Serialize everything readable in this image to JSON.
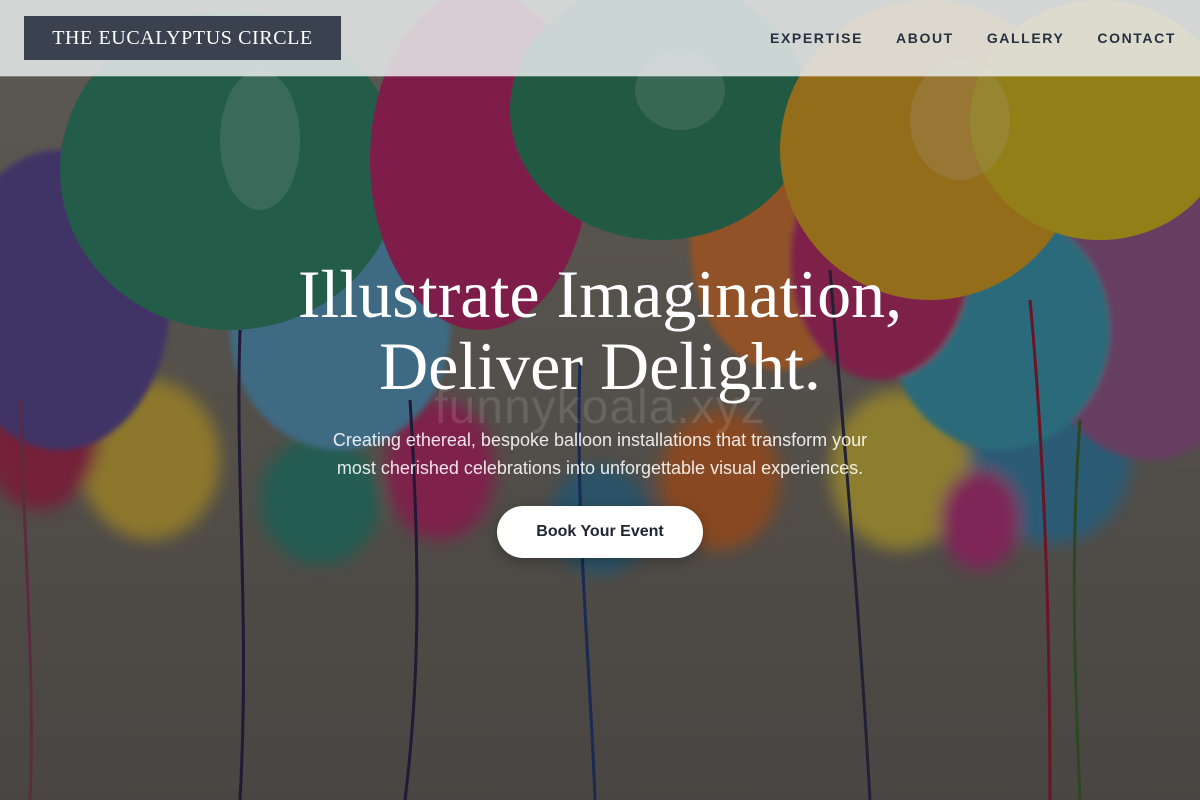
{
  "brand": {
    "name": "THE EUCALYPTUS CIRCLE"
  },
  "nav": {
    "items": [
      {
        "label": "EXPERTISE"
      },
      {
        "label": "ABOUT"
      },
      {
        "label": "GALLERY"
      },
      {
        "label": "CONTACT"
      }
    ]
  },
  "hero": {
    "headline_line1": "Illustrate Imagination,",
    "headline_line2": "Deliver Delight.",
    "subtitle_line1": "Creating ethereal, bespoke balloon installations that transform your",
    "subtitle_line2": "most cherished celebrations into unforgettable visual experiences.",
    "cta_label": "Book Your Event",
    "watermark": "funnykoala.xyz",
    "background_image": "colorful-balloons-photo"
  },
  "colors": {
    "brand_box": "#3a4250",
    "nav_text": "#273040",
    "cta_bg": "#ffffff",
    "cta_text": "#1e2430"
  }
}
